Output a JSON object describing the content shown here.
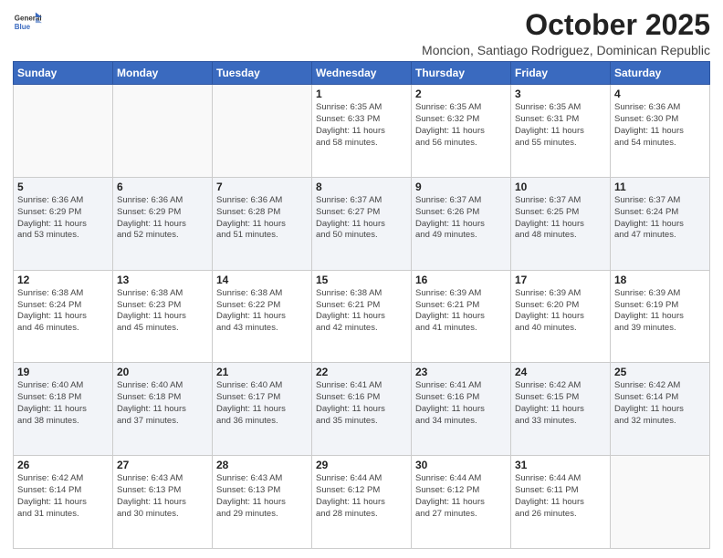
{
  "header": {
    "logo_general": "General",
    "logo_blue": "Blue",
    "month_year": "October 2025",
    "location": "Moncion, Santiago Rodriguez, Dominican Republic"
  },
  "days_of_week": [
    "Sunday",
    "Monday",
    "Tuesday",
    "Wednesday",
    "Thursday",
    "Friday",
    "Saturday"
  ],
  "weeks": [
    {
      "days": [
        {
          "num": "",
          "info": ""
        },
        {
          "num": "",
          "info": ""
        },
        {
          "num": "",
          "info": ""
        },
        {
          "num": "1",
          "info": "Sunrise: 6:35 AM\nSunset: 6:33 PM\nDaylight: 11 hours\nand 58 minutes."
        },
        {
          "num": "2",
          "info": "Sunrise: 6:35 AM\nSunset: 6:32 PM\nDaylight: 11 hours\nand 56 minutes."
        },
        {
          "num": "3",
          "info": "Sunrise: 6:35 AM\nSunset: 6:31 PM\nDaylight: 11 hours\nand 55 minutes."
        },
        {
          "num": "4",
          "info": "Sunrise: 6:36 AM\nSunset: 6:30 PM\nDaylight: 11 hours\nand 54 minutes."
        }
      ]
    },
    {
      "days": [
        {
          "num": "5",
          "info": "Sunrise: 6:36 AM\nSunset: 6:29 PM\nDaylight: 11 hours\nand 53 minutes."
        },
        {
          "num": "6",
          "info": "Sunrise: 6:36 AM\nSunset: 6:29 PM\nDaylight: 11 hours\nand 52 minutes."
        },
        {
          "num": "7",
          "info": "Sunrise: 6:36 AM\nSunset: 6:28 PM\nDaylight: 11 hours\nand 51 minutes."
        },
        {
          "num": "8",
          "info": "Sunrise: 6:37 AM\nSunset: 6:27 PM\nDaylight: 11 hours\nand 50 minutes."
        },
        {
          "num": "9",
          "info": "Sunrise: 6:37 AM\nSunset: 6:26 PM\nDaylight: 11 hours\nand 49 minutes."
        },
        {
          "num": "10",
          "info": "Sunrise: 6:37 AM\nSunset: 6:25 PM\nDaylight: 11 hours\nand 48 minutes."
        },
        {
          "num": "11",
          "info": "Sunrise: 6:37 AM\nSunset: 6:24 PM\nDaylight: 11 hours\nand 47 minutes."
        }
      ]
    },
    {
      "days": [
        {
          "num": "12",
          "info": "Sunrise: 6:38 AM\nSunset: 6:24 PM\nDaylight: 11 hours\nand 46 minutes."
        },
        {
          "num": "13",
          "info": "Sunrise: 6:38 AM\nSunset: 6:23 PM\nDaylight: 11 hours\nand 45 minutes."
        },
        {
          "num": "14",
          "info": "Sunrise: 6:38 AM\nSunset: 6:22 PM\nDaylight: 11 hours\nand 43 minutes."
        },
        {
          "num": "15",
          "info": "Sunrise: 6:38 AM\nSunset: 6:21 PM\nDaylight: 11 hours\nand 42 minutes."
        },
        {
          "num": "16",
          "info": "Sunrise: 6:39 AM\nSunset: 6:21 PM\nDaylight: 11 hours\nand 41 minutes."
        },
        {
          "num": "17",
          "info": "Sunrise: 6:39 AM\nSunset: 6:20 PM\nDaylight: 11 hours\nand 40 minutes."
        },
        {
          "num": "18",
          "info": "Sunrise: 6:39 AM\nSunset: 6:19 PM\nDaylight: 11 hours\nand 39 minutes."
        }
      ]
    },
    {
      "days": [
        {
          "num": "19",
          "info": "Sunrise: 6:40 AM\nSunset: 6:18 PM\nDaylight: 11 hours\nand 38 minutes."
        },
        {
          "num": "20",
          "info": "Sunrise: 6:40 AM\nSunset: 6:18 PM\nDaylight: 11 hours\nand 37 minutes."
        },
        {
          "num": "21",
          "info": "Sunrise: 6:40 AM\nSunset: 6:17 PM\nDaylight: 11 hours\nand 36 minutes."
        },
        {
          "num": "22",
          "info": "Sunrise: 6:41 AM\nSunset: 6:16 PM\nDaylight: 11 hours\nand 35 minutes."
        },
        {
          "num": "23",
          "info": "Sunrise: 6:41 AM\nSunset: 6:16 PM\nDaylight: 11 hours\nand 34 minutes."
        },
        {
          "num": "24",
          "info": "Sunrise: 6:42 AM\nSunset: 6:15 PM\nDaylight: 11 hours\nand 33 minutes."
        },
        {
          "num": "25",
          "info": "Sunrise: 6:42 AM\nSunset: 6:14 PM\nDaylight: 11 hours\nand 32 minutes."
        }
      ]
    },
    {
      "days": [
        {
          "num": "26",
          "info": "Sunrise: 6:42 AM\nSunset: 6:14 PM\nDaylight: 11 hours\nand 31 minutes."
        },
        {
          "num": "27",
          "info": "Sunrise: 6:43 AM\nSunset: 6:13 PM\nDaylight: 11 hours\nand 30 minutes."
        },
        {
          "num": "28",
          "info": "Sunrise: 6:43 AM\nSunset: 6:13 PM\nDaylight: 11 hours\nand 29 minutes."
        },
        {
          "num": "29",
          "info": "Sunrise: 6:44 AM\nSunset: 6:12 PM\nDaylight: 11 hours\nand 28 minutes."
        },
        {
          "num": "30",
          "info": "Sunrise: 6:44 AM\nSunset: 6:12 PM\nDaylight: 11 hours\nand 27 minutes."
        },
        {
          "num": "31",
          "info": "Sunrise: 6:44 AM\nSunset: 6:11 PM\nDaylight: 11 hours\nand 26 minutes."
        },
        {
          "num": "",
          "info": ""
        }
      ]
    }
  ]
}
